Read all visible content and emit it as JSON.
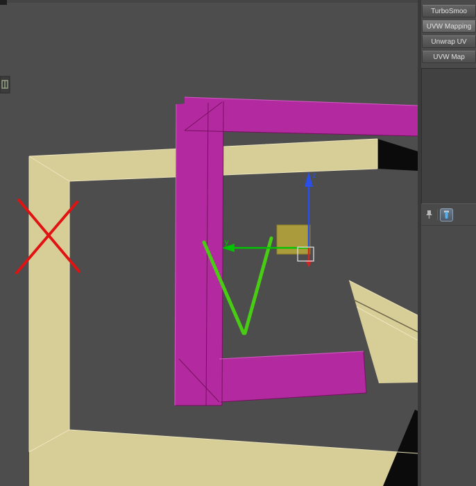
{
  "viewport": {
    "colors": {
      "background": "#4d4d4d",
      "tan": "#d7cd97",
      "magenta": "#b32aa0",
      "dark_face": "#0b0b0b",
      "red_annotation": "#e01212",
      "green_annotation": "#49cd14",
      "axis_x": "#cf2525",
      "axis_y": "#00c400",
      "axis_z": "#2a4fe8",
      "plane_handle": "#b2a23b"
    },
    "gizmo": {
      "z_label": "z",
      "y_label": "y"
    }
  },
  "panel": {
    "modifier_buttons": [
      {
        "label": "TurboSmoo"
      },
      {
        "label": "UVW Mapping"
      },
      {
        "label": "Unwrap UV"
      },
      {
        "label": "UVW Map"
      }
    ],
    "toolbar": {
      "glyph_color": "#55b1e8"
    },
    "icons": {
      "pin_stack": "pushpin",
      "show_end_result": "test-tube",
      "layout_tab": "layout-grid"
    }
  }
}
